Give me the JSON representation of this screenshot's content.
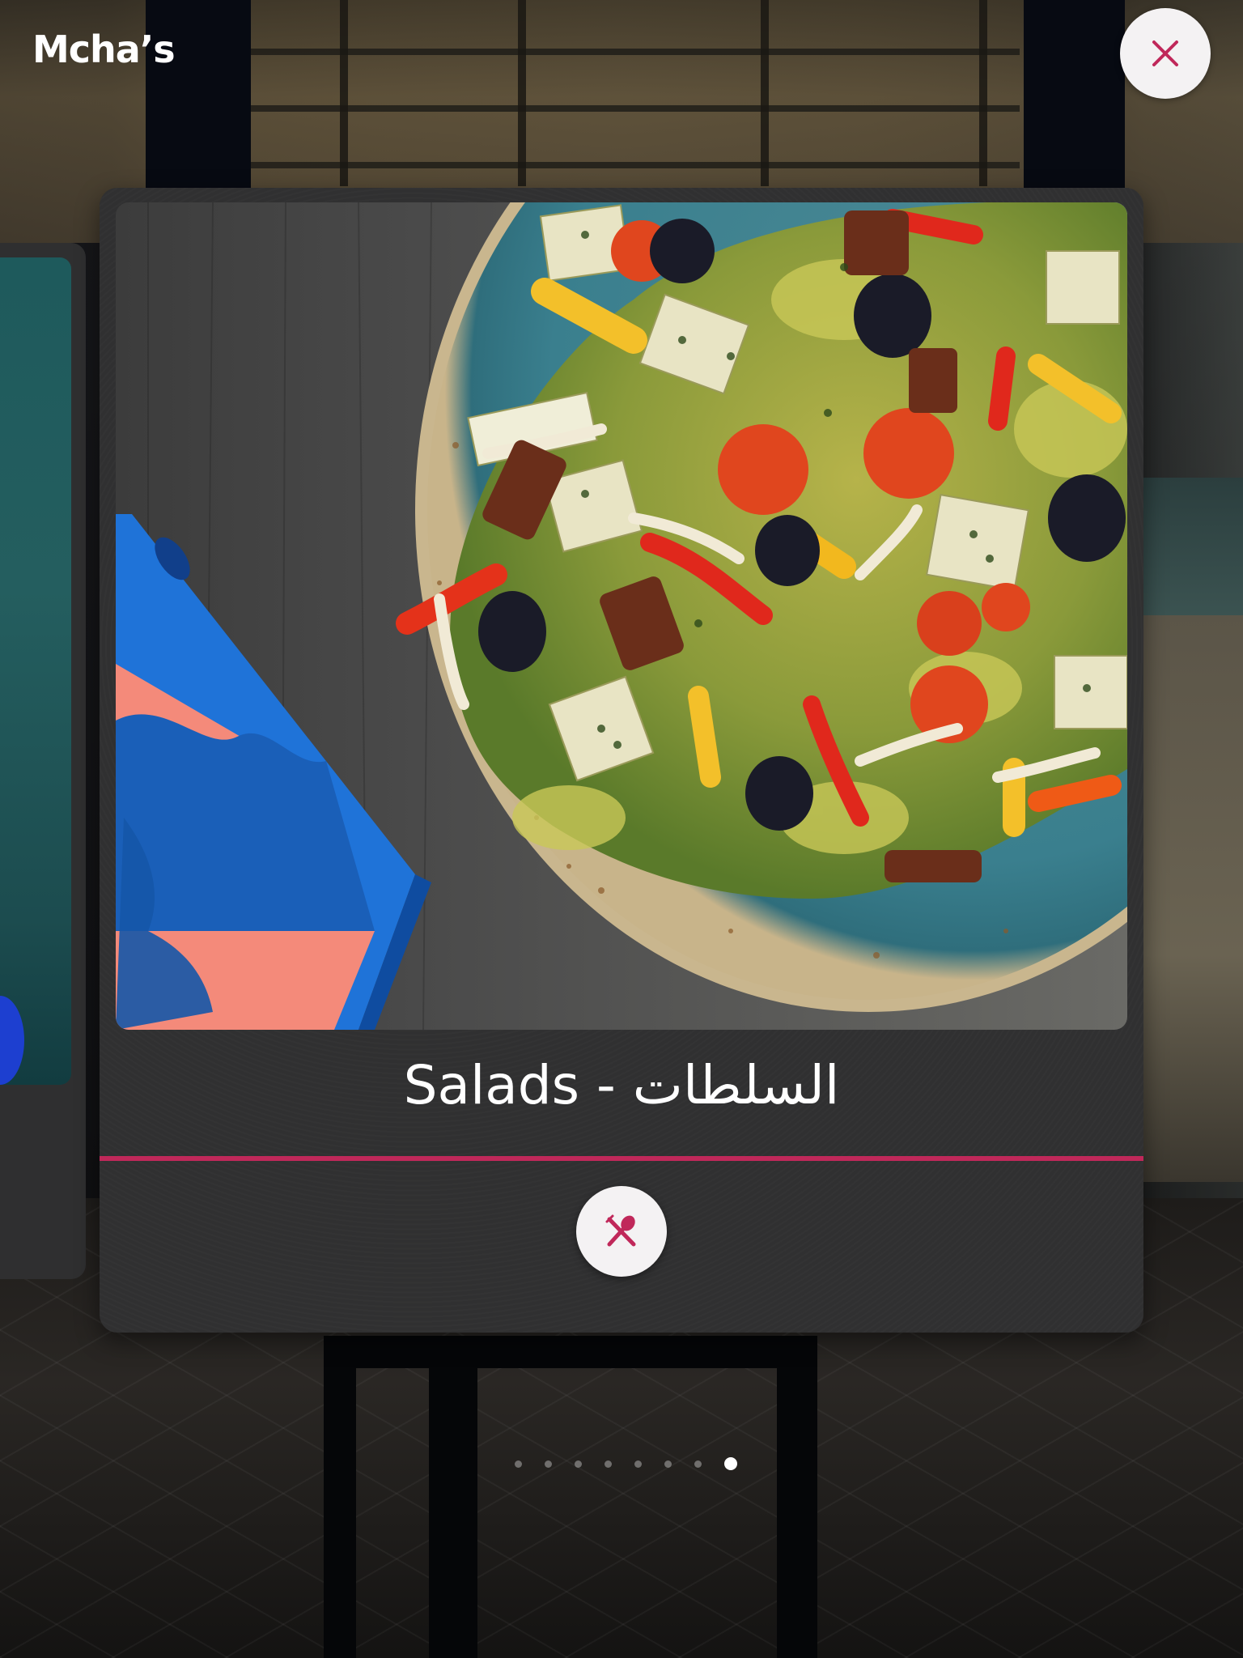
{
  "app": {
    "brand": "Mcha’s"
  },
  "header": {
    "close_icon": "close-icon"
  },
  "carousel": {
    "active_index": 7,
    "total": 8,
    "cards": [
      {
        "title": "السلطات - Salads",
        "image": "salad-bowl-photo",
        "action_icon": "fork-spoon-icon"
      }
    ]
  },
  "colors": {
    "accent": "#c0285a",
    "card_bg": "#303031",
    "button_bg": "#f4f2f3",
    "text": "#ffffff"
  }
}
